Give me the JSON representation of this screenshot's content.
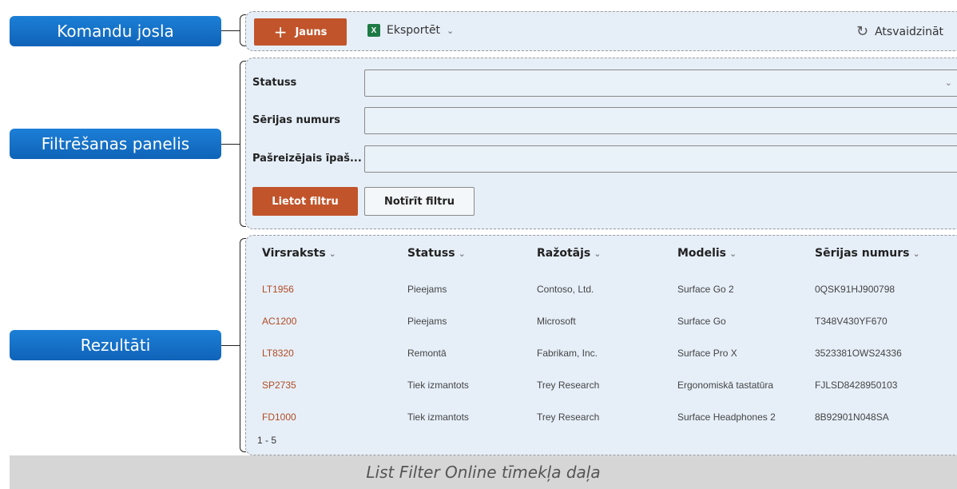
{
  "callouts": {
    "command_bar": "Komandu josla",
    "filter_panel": "Filtrēšanas panelis",
    "results": "Rezultāti"
  },
  "command_bar": {
    "new_button": "Jauns",
    "export_button": "Eksportēt",
    "refresh_button": "Atsvaidzināt"
  },
  "filters": {
    "fields": [
      {
        "label": "Statuss",
        "value": "",
        "type": "dropdown"
      },
      {
        "label": "Sērijas numurs",
        "value": "",
        "type": "text"
      },
      {
        "label": "Pašreizējais īpaš...",
        "value": "",
        "type": "text"
      }
    ],
    "apply_button": "Lietot filtru",
    "clear_button": "Notīrīt filtru"
  },
  "results": {
    "columns": [
      "Virsraksts",
      "Statuss",
      "Ražotājs",
      "Modelis",
      "Sērijas numurs"
    ],
    "rows": [
      [
        "LT1956",
        "Pieejams",
        "Contoso, Ltd.",
        "Surface Go 2",
        "0QSK91HJ900798"
      ],
      [
        "AC1200",
        "Pieejams",
        "Microsoft",
        "Surface Go",
        "T348V430YF670"
      ],
      [
        "LT8320",
        "Remontā",
        "Fabrikam, Inc.",
        "Surface Pro X",
        "3523381OWS24336"
      ],
      [
        "SP2735",
        "Tiek izmantots",
        "Trey Research",
        "Ergonomiskā tastatūra",
        "FJLSD8428950103"
      ],
      [
        "FD1000",
        "Tiek izmantots",
        "Trey Research",
        "Surface Headphones 2",
        "8B92901N048SA"
      ]
    ],
    "pager": "1 - 5"
  },
  "caption": "List Filter Online tīmekļa daļa",
  "colors": {
    "accent": "#c1542b",
    "callout": "#1470c8",
    "panel": "#e6eff8"
  }
}
